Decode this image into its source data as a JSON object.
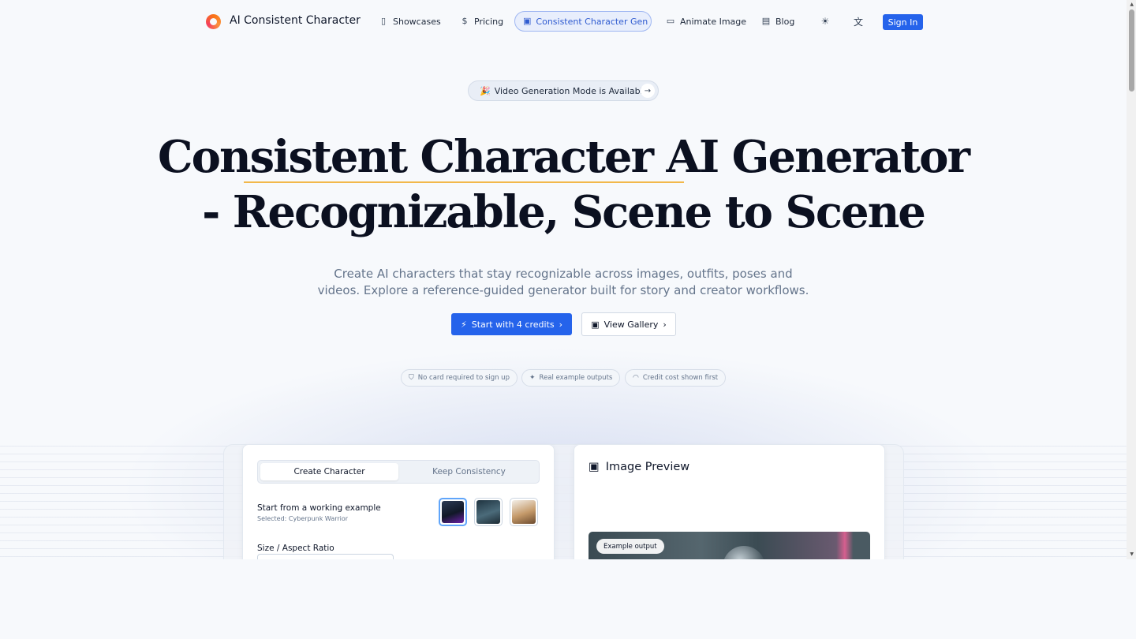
{
  "nav": {
    "brand": "AI Consistent Character",
    "items": [
      {
        "label": "Showcases",
        "icon": "columns-icon"
      },
      {
        "label": "Pricing",
        "icon": "dollar-icon"
      },
      {
        "label": "Consistent Character Gen",
        "icon": "image-icon",
        "active": true
      },
      {
        "label": "Animate Image",
        "icon": "video-icon"
      },
      {
        "label": "Blog",
        "icon": "newspaper-icon"
      }
    ],
    "theme_icon": "sun-icon",
    "language_icon": "translate-icon",
    "signin_label": "Sign In"
  },
  "badge": {
    "emoji": "🎉",
    "text": "Video Generation Mode is Available"
  },
  "hero": {
    "title_line1": "Consistent Character AI Generator",
    "title_line2": "- Recognizable, Scene to Scene",
    "subtitle_line1": "Create AI characters that stay recognizable across images, outfits, poses and",
    "subtitle_line2": "videos. Explore a reference-guided generator built for story and creator workflows.",
    "cta_primary": "Start with 4 credits",
    "cta_secondary": "View Gallery"
  },
  "chips": [
    {
      "label": "No card required to sign up",
      "icon": "shield-icon"
    },
    {
      "label": "Real example outputs",
      "icon": "sparkle-icon"
    },
    {
      "label": "Credit cost shown first",
      "icon": "gauge-icon"
    }
  ],
  "generator": {
    "tabs": [
      "Create Character",
      "Keep Consistency"
    ],
    "example_title": "Start from a working example",
    "example_selected": "Selected: Cyberpunk Warrior",
    "size_label": "Size / Aspect Ratio"
  },
  "preview": {
    "title": "Image Preview",
    "example_pill": "Example output"
  },
  "colors": {
    "accent": "#2563eb",
    "underline": "#f2b84b",
    "active_nav_bg": "#e8eefc"
  }
}
